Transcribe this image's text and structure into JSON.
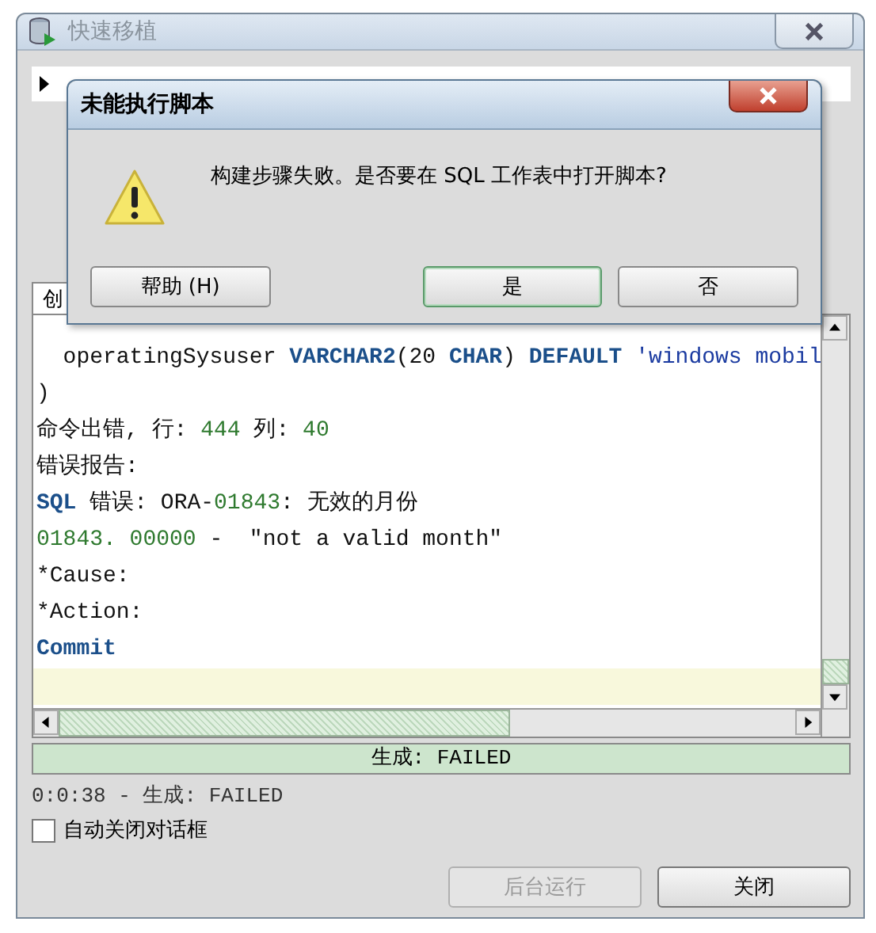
{
  "window": {
    "title": "快速移植"
  },
  "tree_item": {
    "expanded": false
  },
  "tab": {
    "label": "创",
    "selected": true
  },
  "code_lines": [
    [
      {
        "kind": "plain",
        "text": "  operatingSysuser "
      },
      {
        "kind": "keyword",
        "text": "VARCHAR2"
      },
      {
        "kind": "plain",
        "text": "(20 "
      },
      {
        "kind": "keyword",
        "text": "CHAR"
      },
      {
        "kind": "plain",
        "text": ") "
      },
      {
        "kind": "keyword",
        "text": "DEFAULT"
      },
      {
        "kind": "string",
        "text": " 'windows mobil"
      }
    ],
    [
      {
        "kind": "plain",
        "text": ")"
      }
    ],
    [
      {
        "kind": "plain",
        "text": "命令出错, 行: "
      },
      {
        "kind": "number",
        "text": "444"
      },
      {
        "kind": "plain",
        "text": " 列: "
      },
      {
        "kind": "number",
        "text": "40"
      }
    ],
    [
      {
        "kind": "plain",
        "text": "错误报告:"
      }
    ],
    [
      {
        "kind": "keyword",
        "text": "SQL"
      },
      {
        "kind": "plain",
        "text": " 错误: ORA-"
      },
      {
        "kind": "number",
        "text": "01843"
      },
      {
        "kind": "plain",
        "text": ": 无效的月份"
      }
    ],
    [
      {
        "kind": "number",
        "text": "01843. 00000"
      },
      {
        "kind": "plain",
        "text": " -  \"not a valid month\""
      }
    ],
    [
      {
        "kind": "plain",
        "text": "*Cause:"
      }
    ],
    [
      {
        "kind": "plain",
        "text": "*Action:"
      }
    ],
    [
      {
        "kind": "keyword",
        "text": "Commit"
      }
    ]
  ],
  "status_bar": "生成: FAILED",
  "elapsed": "0:0:38 - 生成: FAILED",
  "auto_close": {
    "label": "自动关闭对话框",
    "checked": false
  },
  "buttons": [
    {
      "label": "后台运行",
      "disabled": true
    },
    {
      "label": "关闭",
      "disabled": false
    }
  ],
  "dialog": {
    "title": "未能执行脚本",
    "message": "构建步骤失败。是否要在 SQL 工作表中打开脚本?",
    "buttons": [
      {
        "label": "帮助 (H)",
        "default": false
      },
      {
        "label": "是",
        "default": true
      },
      {
        "label": "否",
        "default": false
      }
    ]
  }
}
